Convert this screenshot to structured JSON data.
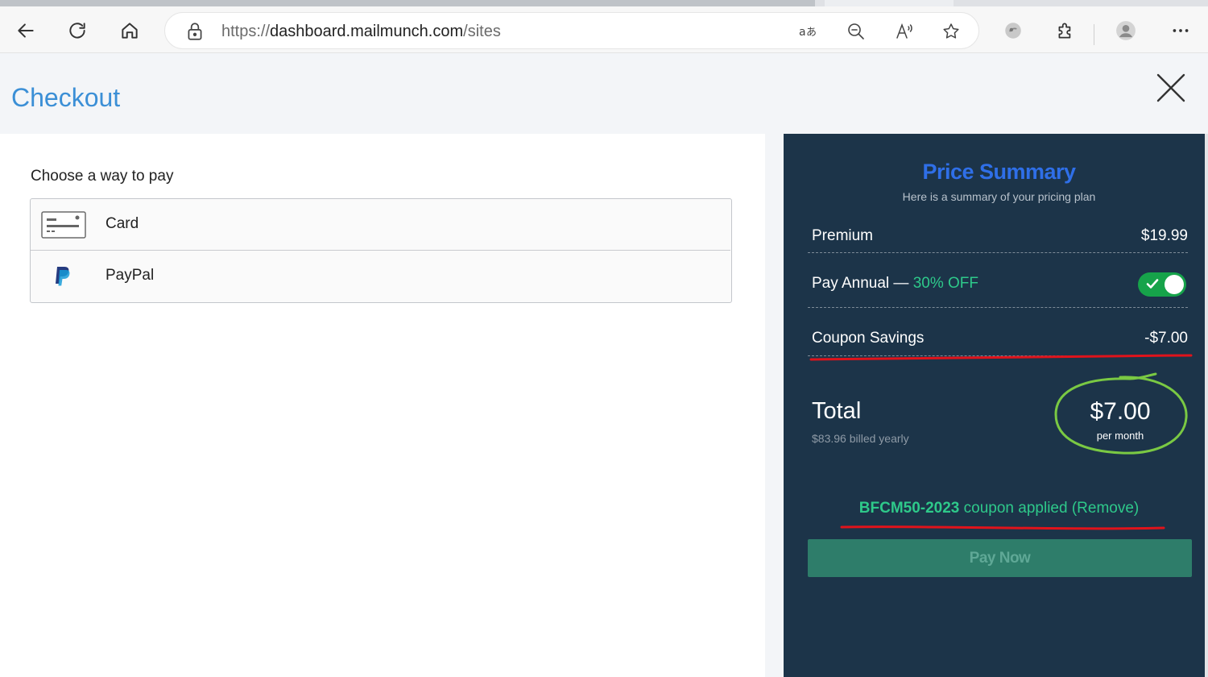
{
  "browser": {
    "url_scheme": "https://",
    "url_host": "dashboard.mailmunch.com",
    "url_path": "/sites",
    "buttons": {
      "back": "back-arrow-icon",
      "refresh": "refresh-icon",
      "home": "home-icon",
      "translate": "translate-icon",
      "zoom": "zoom-out-icon",
      "read_aloud": "read-aloud-icon",
      "favorite": "star-icon",
      "extension_color": "colorful-extension-icon",
      "extensions": "puzzle-icon",
      "profile": "avatar-icon",
      "menu": "more-icon"
    }
  },
  "header": {
    "title": "Checkout",
    "close_icon": "close-icon"
  },
  "payment": {
    "heading": "Choose a way to pay",
    "methods": [
      {
        "label": "Card",
        "icon": "credit-card-icon"
      },
      {
        "label": "PayPal",
        "icon": "paypal-icon"
      }
    ]
  },
  "summary": {
    "title": "Price Summary",
    "subtitle": "Here is a summary of your pricing plan",
    "plan_label": "Premium",
    "plan_price": "$19.99",
    "annual_label": "Pay Annual —",
    "annual_discount": "30% OFF",
    "annual_toggle_on": true,
    "coupon_label": "Coupon Savings",
    "coupon_value": "-$7.00",
    "total_label": "Total",
    "total_billed": "$83.96 billed yearly",
    "total_price": "$7.00",
    "total_period": "per month",
    "coupon_code": "BFCM50-2023",
    "coupon_applied_text": "coupon applied",
    "coupon_remove": "(Remove)",
    "pay_button": "Pay Now"
  },
  "colors": {
    "title_blue": "#3b8fd6",
    "panel_bg": "#1c3449",
    "accent_green": "#2ec98a",
    "annotation_red": "#e0131b",
    "annotation_green": "#7ac943"
  }
}
